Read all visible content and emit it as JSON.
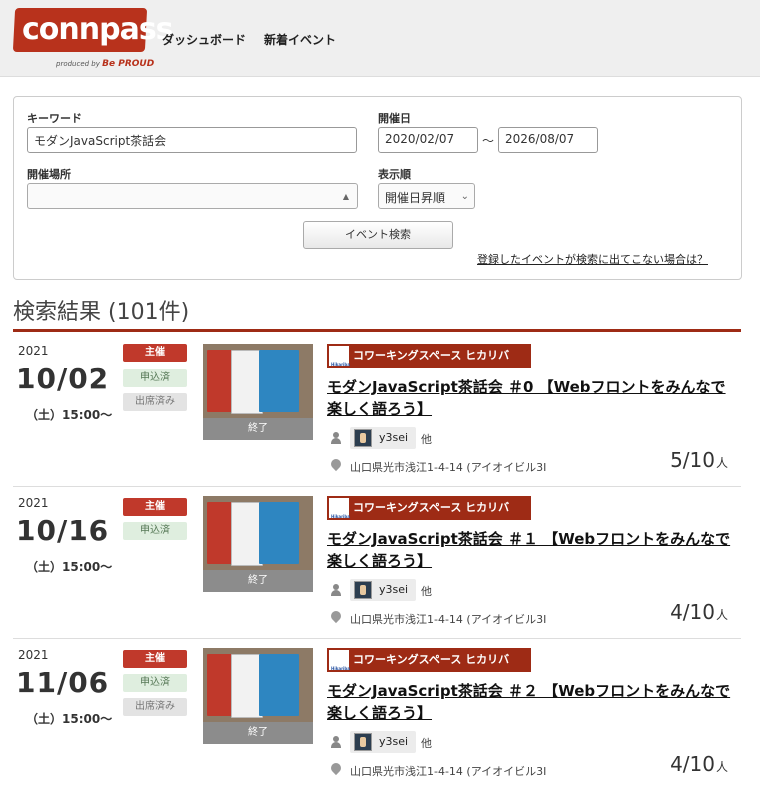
{
  "header": {
    "logo_text": "connpass",
    "logo_sub_prefix": "produced by",
    "logo_sub_brand": "Be PROUD",
    "nav": [
      "ダッシュボード",
      "新着イベント"
    ]
  },
  "search": {
    "keyword_label": "キーワード",
    "keyword_value": "モダンJavaScript茶話会",
    "date_label": "開催日",
    "date_from": "2020/02/07",
    "date_sep": "〜",
    "date_to": "2026/08/07",
    "place_label": "開催場所",
    "place_value": "",
    "sort_label": "表示順",
    "sort_value": "開催日昇順",
    "submit_label": "イベント検索",
    "help_link": "登録したイベントが検索に出てこない場合は？"
  },
  "results": {
    "title": "検索結果 (101件)",
    "events": [
      {
        "year": "2021",
        "date": "10/02",
        "time": "（土）15:00〜",
        "badges": [
          "主催",
          "申込済",
          "出席済み"
        ],
        "thumb_status": "終了",
        "group_name": "コワーキングスペース ヒカリバ",
        "group_icon_text": "Hikariba",
        "title": "モダンJavaScript茶話会 ＃0 【Webフロントをみんなで楽しく語ろう】",
        "user": "y3sei",
        "others": "他",
        "location": "山口県光市浅江1-4-14 (アイオイビル3I",
        "count": "5/10",
        "count_unit": "人"
      },
      {
        "year": "2021",
        "date": "10/16",
        "time": "（土）15:00〜",
        "badges": [
          "主催",
          "申込済"
        ],
        "thumb_status": "終了",
        "group_name": "コワーキングスペース ヒカリバ",
        "group_icon_text": "Hikariba",
        "title": "モダンJavaScript茶話会 ＃１ 【Webフロントをみんなで楽しく語ろう】",
        "user": "y3sei",
        "others": "他",
        "location": "山口県光市浅江1-4-14 (アイオイビル3I",
        "count": "4/10",
        "count_unit": "人"
      },
      {
        "year": "2021",
        "date": "11/06",
        "time": "（土）15:00〜",
        "badges": [
          "主催",
          "申込済",
          "出席済み"
        ],
        "thumb_status": "終了",
        "group_name": "コワーキングスペース ヒカリバ",
        "group_icon_text": "Hikariba",
        "title": "モダンJavaScript茶話会 ＃２ 【Webフロントをみんなで楽しく語ろう】",
        "user": "y3sei",
        "others": "他",
        "location": "山口県光市浅江1-4-14 (アイオイビル3I",
        "count": "4/10",
        "count_unit": "人"
      }
    ]
  },
  "colors": {
    "brand": "#b8321c",
    "rule": "#9e2b15",
    "host_badge": "#c0392b"
  }
}
